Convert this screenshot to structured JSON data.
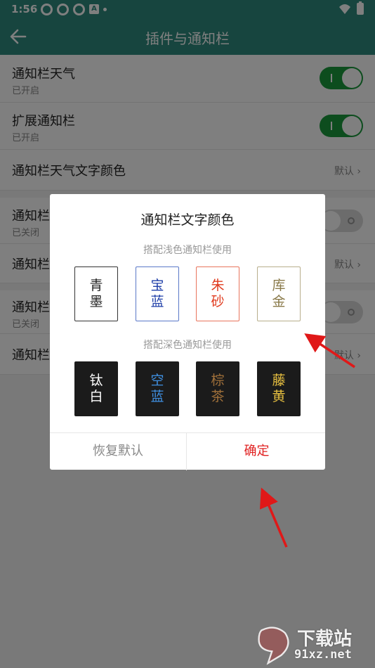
{
  "status": {
    "time": "1:56",
    "letter": "A"
  },
  "header": {
    "title": "插件与通知栏"
  },
  "settings": [
    {
      "title": "通知栏天气",
      "subtitle": "已开启",
      "toggle": "on"
    },
    {
      "title": "扩展通知栏",
      "subtitle": "已开启",
      "toggle": "on"
    },
    {
      "title": "通知栏天气文字颜色",
      "value": "默认"
    },
    {
      "title": "通知栏",
      "subtitle": "已关闭",
      "toggle": "off"
    },
    {
      "title": "通知栏",
      "value": "默认"
    },
    {
      "title": "通知栏",
      "subtitle": "已关闭",
      "toggle": "off"
    },
    {
      "title": "通知栏",
      "value": "默认"
    }
  ],
  "dialog": {
    "title": "通知栏文字颜色",
    "light_label": "搭配浅色通知栏使用",
    "dark_label": "搭配深色通知栏使用",
    "light_options": [
      {
        "line1": "青",
        "line2": "墨",
        "color": "#222222",
        "border": "#333333"
      },
      {
        "line1": "宝",
        "line2": "蓝",
        "color": "#1f3fa8",
        "border": "#5a78c8"
      },
      {
        "line1": "朱",
        "line2": "砂",
        "color": "#e03a1e",
        "border": "#e8745c"
      },
      {
        "line1": "库",
        "line2": "金",
        "color": "#8a7a4a",
        "border": "#b8ae8c"
      }
    ],
    "dark_options": [
      {
        "line1": "钛",
        "line2": "白",
        "color": "#ffffff"
      },
      {
        "line1": "空",
        "line2": "蓝",
        "color": "#3f8fe0"
      },
      {
        "line1": "棕",
        "line2": "茶",
        "color": "#a0703a"
      },
      {
        "line1": "藤",
        "line2": "黄",
        "color": "#e8c040"
      }
    ],
    "reset_label": "恢复默认",
    "confirm_label": "确定"
  },
  "watermark": {
    "text": "下载站",
    "url": "91xz.net"
  }
}
